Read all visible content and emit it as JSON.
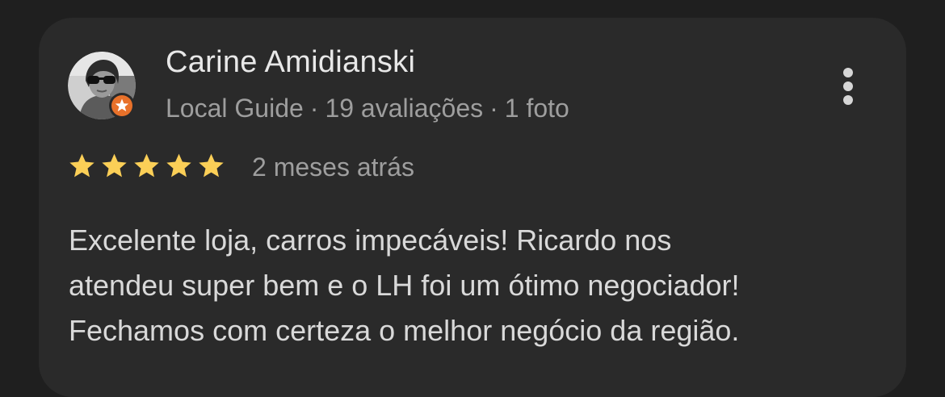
{
  "review": {
    "reviewer_name": "Carine Amidianski",
    "reviewer_level": "Local Guide",
    "reviewer_reviews": "19 avaliações",
    "reviewer_photos": "1 foto",
    "meta_separator": "·",
    "rating": 5,
    "rating_max": 5,
    "time": "2 meses atrás",
    "text_lines": [
      "Excelente loja, carros impecáveis! Ricardo nos",
      "atendeu super bem e o LH foi um ótimo negociador!",
      "Fechamos com certeza o melhor negócio da região."
    ]
  },
  "icons": {
    "badge": "local-guide-star-icon",
    "menu": "more-vert-icon",
    "star": "star-icon"
  },
  "colors": {
    "background": "#1f1f1f",
    "card": "#2a2a2a",
    "star": "#fbcf57",
    "badge": "#e8712a",
    "name": "#e8e8e8",
    "secondary": "#9e9e9e",
    "body": "#d9d9d9"
  }
}
